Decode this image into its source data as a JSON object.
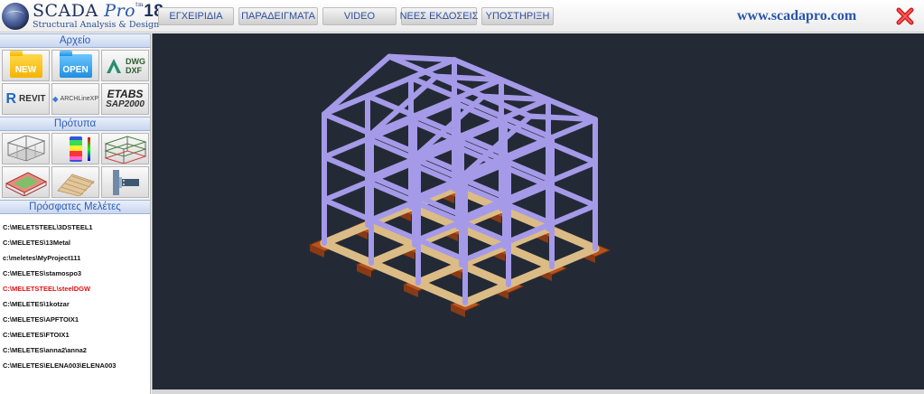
{
  "app": {
    "logo_main": "SCADA",
    "logo_pro": "Pro",
    "logo_tm": "tm",
    "logo_version": "18",
    "logo_subtitle": "Structural Analysis & Design",
    "website": "www.scadapro.com"
  },
  "nav": [
    {
      "label": "ΕΓΧΕΙΡΙΔΙΑ"
    },
    {
      "label": "ΠΑΡΑΔΕΙΓΜΑΤΑ"
    },
    {
      "label": "VIDEO"
    },
    {
      "label": "ΝΕΕΣ ΕΚΔΟΣΕΙΣ"
    },
    {
      "label": "ΥΠΟΣΤΗΡΙΞΗ"
    }
  ],
  "sections": {
    "file": "Αρχείο",
    "templates": "Πρότυπα",
    "recent": "Πρόσφατες Μελέτες"
  },
  "file_tiles": {
    "new": "NEW",
    "open": "OPEN",
    "dwg": "DWG",
    "dxf": "DXF",
    "revit": "REVIT",
    "archi": "ARCHLineXP",
    "etabs": "ETABS",
    "sap": "SAP2000"
  },
  "template_tiles": [
    {
      "icon": "steel-frame-icon"
    },
    {
      "icon": "stress-contour-icon"
    },
    {
      "icon": "multistory-frame-icon"
    },
    {
      "icon": "slab-foundation-icon"
    },
    {
      "icon": "timber-roof-icon"
    },
    {
      "icon": "steel-connection-icon"
    }
  ],
  "recent_projects": [
    {
      "path": "C:\\MELETSTEEL\\3DSTEEL1",
      "active": false
    },
    {
      "path": "C:\\MELETES\\13Metal",
      "active": false
    },
    {
      "path": "c:\\meletes\\MyProject111",
      "active": false
    },
    {
      "path": "C:\\MELETES\\stamospo3",
      "active": false
    },
    {
      "path": "C:\\MELETSTEEL\\steelDGW",
      "active": true
    },
    {
      "path": "C:\\MELETES\\1kotzar",
      "active": false
    },
    {
      "path": "C:\\MELETES\\APFTOIX1",
      "active": false
    },
    {
      "path": "C:\\MELETES\\FTOIX1",
      "active": false
    },
    {
      "path": "C:\\MELETES\\anna2\\anna2",
      "active": false
    },
    {
      "path": "C:\\MELETES\\ELENA003\\ELENA003",
      "active": false
    }
  ],
  "colors": {
    "viewport_bg": "#232a36",
    "frame_member": "#a59ae8",
    "foundation_beam": "#dcbc86",
    "footing": "#b8521f",
    "active_recent": "#e01010",
    "accent_blue": "#2e5db5"
  },
  "viewport": {
    "content": "3D structural model"
  }
}
